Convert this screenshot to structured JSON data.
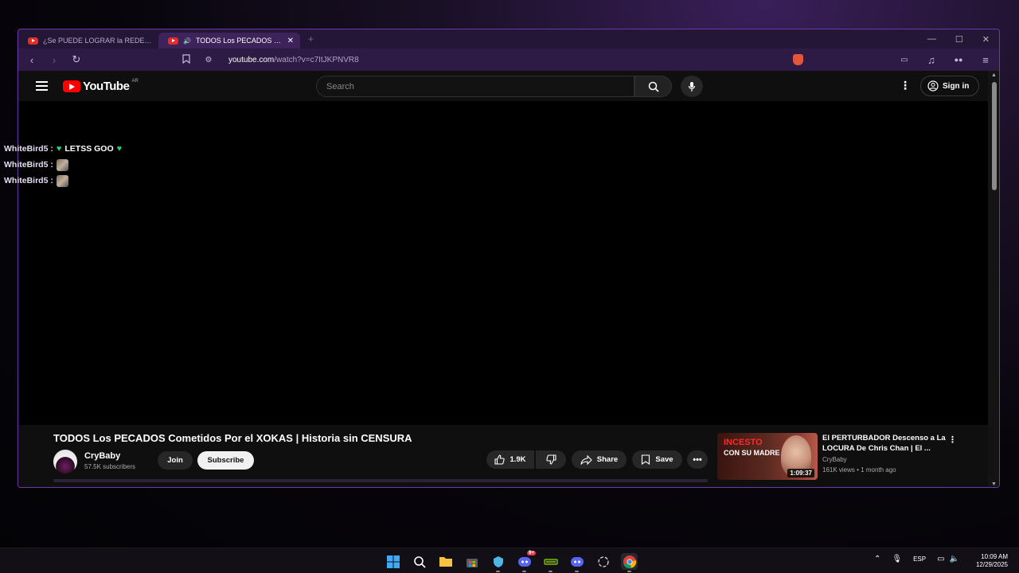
{
  "browser": {
    "tabs": [
      {
        "title": "¿Se PUEDE LOGRAR la REDENCIÓN?",
        "active": false
      },
      {
        "title": "TODOS Los PECADOS Cometi",
        "active": true
      }
    ],
    "url_domain": "youtube.com",
    "url_path": "/watch?v=c7ItJKPNVR8"
  },
  "youtube": {
    "logo_text": "YouTube",
    "country_code": "AR",
    "search_placeholder": "Search",
    "sign_in_label": "Sign in",
    "video": {
      "title": "TODOS Los PECADOS Cometidos Por el XOKAS | Historia sin CENSURA",
      "channel": "CryBaby",
      "subscribers": "57.5K subscribers",
      "join_label": "Join",
      "subscribe_label": "Subscribe",
      "likes": "1.9K",
      "share_label": "Share",
      "save_label": "Save"
    },
    "recommended": {
      "thumb_line1": "INCESTO",
      "thumb_line2": "CON SU MADRE",
      "duration": "1:09:37",
      "title": "El PERTURBADOR Descenso a La LOCURA De Chris Chan | El ...",
      "channel": "CryBaby",
      "meta": "161K views • 1 month ago"
    }
  },
  "chat_overlay": [
    {
      "user": "WhiteBird5 :",
      "message": "LETSS GOO",
      "hearts": true
    },
    {
      "user": "WhiteBird5 :",
      "message": "",
      "emote": true
    },
    {
      "user": "WhiteBird5 :",
      "message": "",
      "emote": true
    }
  ],
  "taskbar": {
    "language": "ESP",
    "time": "10:09 AM",
    "date": "12/29/2025",
    "discord_badge": "9+"
  },
  "colors": {
    "accent": "#6b39a8",
    "youtube_red": "#ff0000",
    "heart_green": "#2ecc71"
  }
}
